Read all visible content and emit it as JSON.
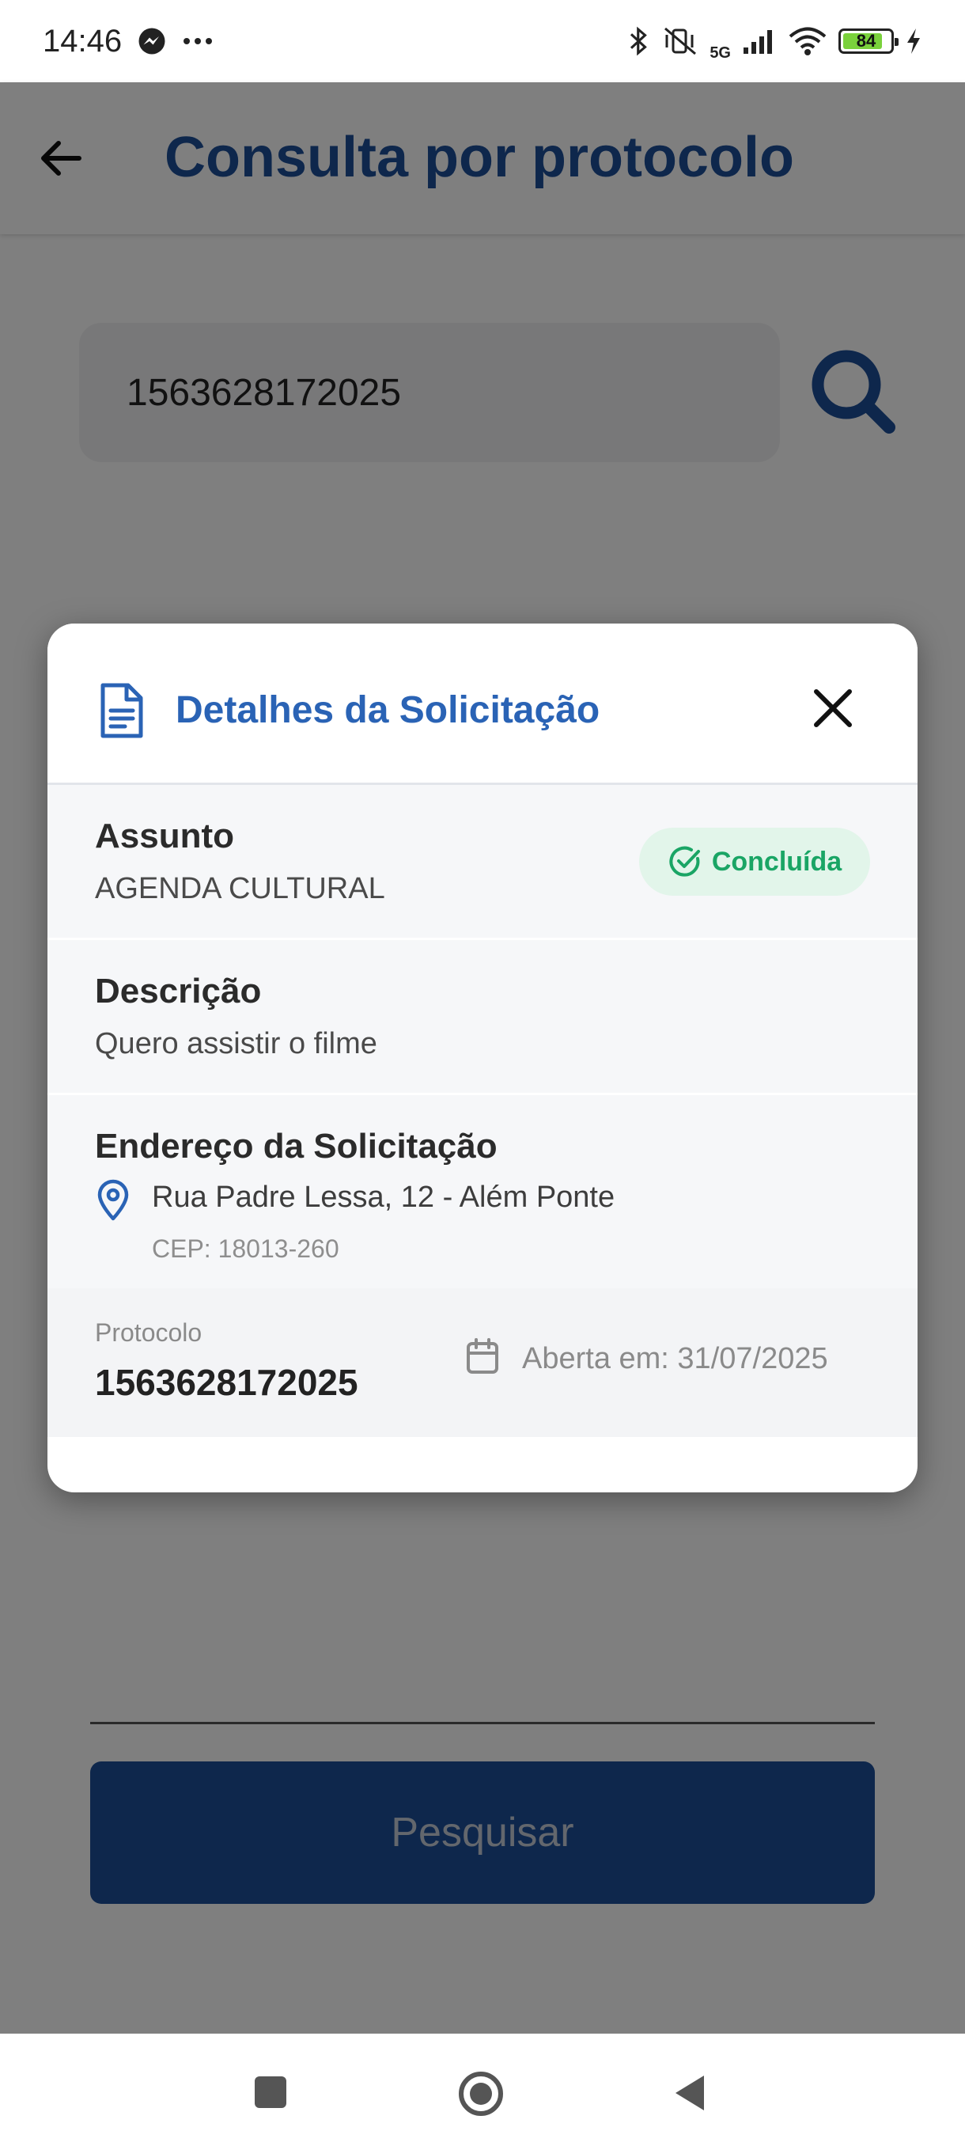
{
  "status_bar": {
    "time": "14:46",
    "battery_level": "84",
    "battery_fraction": 0.84,
    "network": "5G",
    "icons": [
      "messenger-icon",
      "more-icon",
      "bluetooth-icon",
      "vibrate-off-icon",
      "signal-icon",
      "wifi-icon",
      "battery-icon",
      "charging-icon"
    ]
  },
  "app_bar": {
    "title": "Consulta por protocolo",
    "back_icon": "arrow-left-icon"
  },
  "search": {
    "protocol_value": "1563628172025",
    "search_icon": "search-icon",
    "button_label": "Pesquisar"
  },
  "modal": {
    "title": "Detalhes da Solicitação",
    "subject": {
      "label": "Assunto",
      "value": "AGENDA CULTURAL",
      "status": "Concluída"
    },
    "description": {
      "label": "Descrição",
      "value": "Quero assistir o filme"
    },
    "address": {
      "label": "Endereço da Solicitação",
      "street": "Rua Padre Lessa, 12 - Além Ponte",
      "cep": "CEP: 18013-260"
    },
    "footer": {
      "protocol_label": "Protocolo",
      "protocol_value": "1563628172025",
      "opened": "Aberta em: 31/07/2025"
    }
  },
  "colors": {
    "primary": "#1d4e98",
    "modal_title": "#2a63b5",
    "success": "#1aa565",
    "success_bg": "#e2f5ea"
  }
}
